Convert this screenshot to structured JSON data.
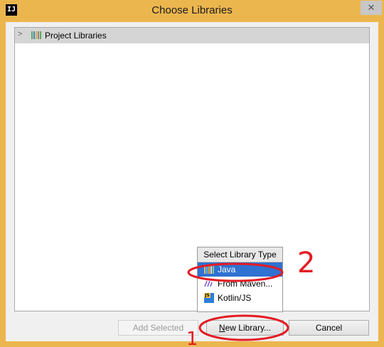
{
  "window": {
    "app_icon": "IJ",
    "title": "Choose Libraries",
    "close_glyph": "✕"
  },
  "tree": {
    "items": [
      {
        "label": "Project Libraries",
        "icon": "library-icon",
        "expanded": false
      }
    ]
  },
  "popup": {
    "title": "Select Library Type",
    "items": [
      {
        "label": "Java",
        "icon": "java-library-icon",
        "selected": true
      },
      {
        "label": "From Maven...",
        "icon": "maven-icon",
        "selected": false
      },
      {
        "label": "Kotlin/JS",
        "icon": "kotlin-js-icon",
        "selected": false
      }
    ]
  },
  "buttons": {
    "add_selected": "Add Selected",
    "new_library_mnemonic": "N",
    "new_library_rest": "ew Library...",
    "cancel": "Cancel"
  },
  "annotations": {
    "mark_1": "1",
    "mark_2": "2",
    "color": "#e41b23"
  },
  "colors": {
    "frame": "#ecb64e",
    "selection": "#2f72d1",
    "library_icon": [
      "#5aa95a",
      "#2f8ad8",
      "#f0a830",
      "#888888",
      "#5aa95a"
    ]
  }
}
